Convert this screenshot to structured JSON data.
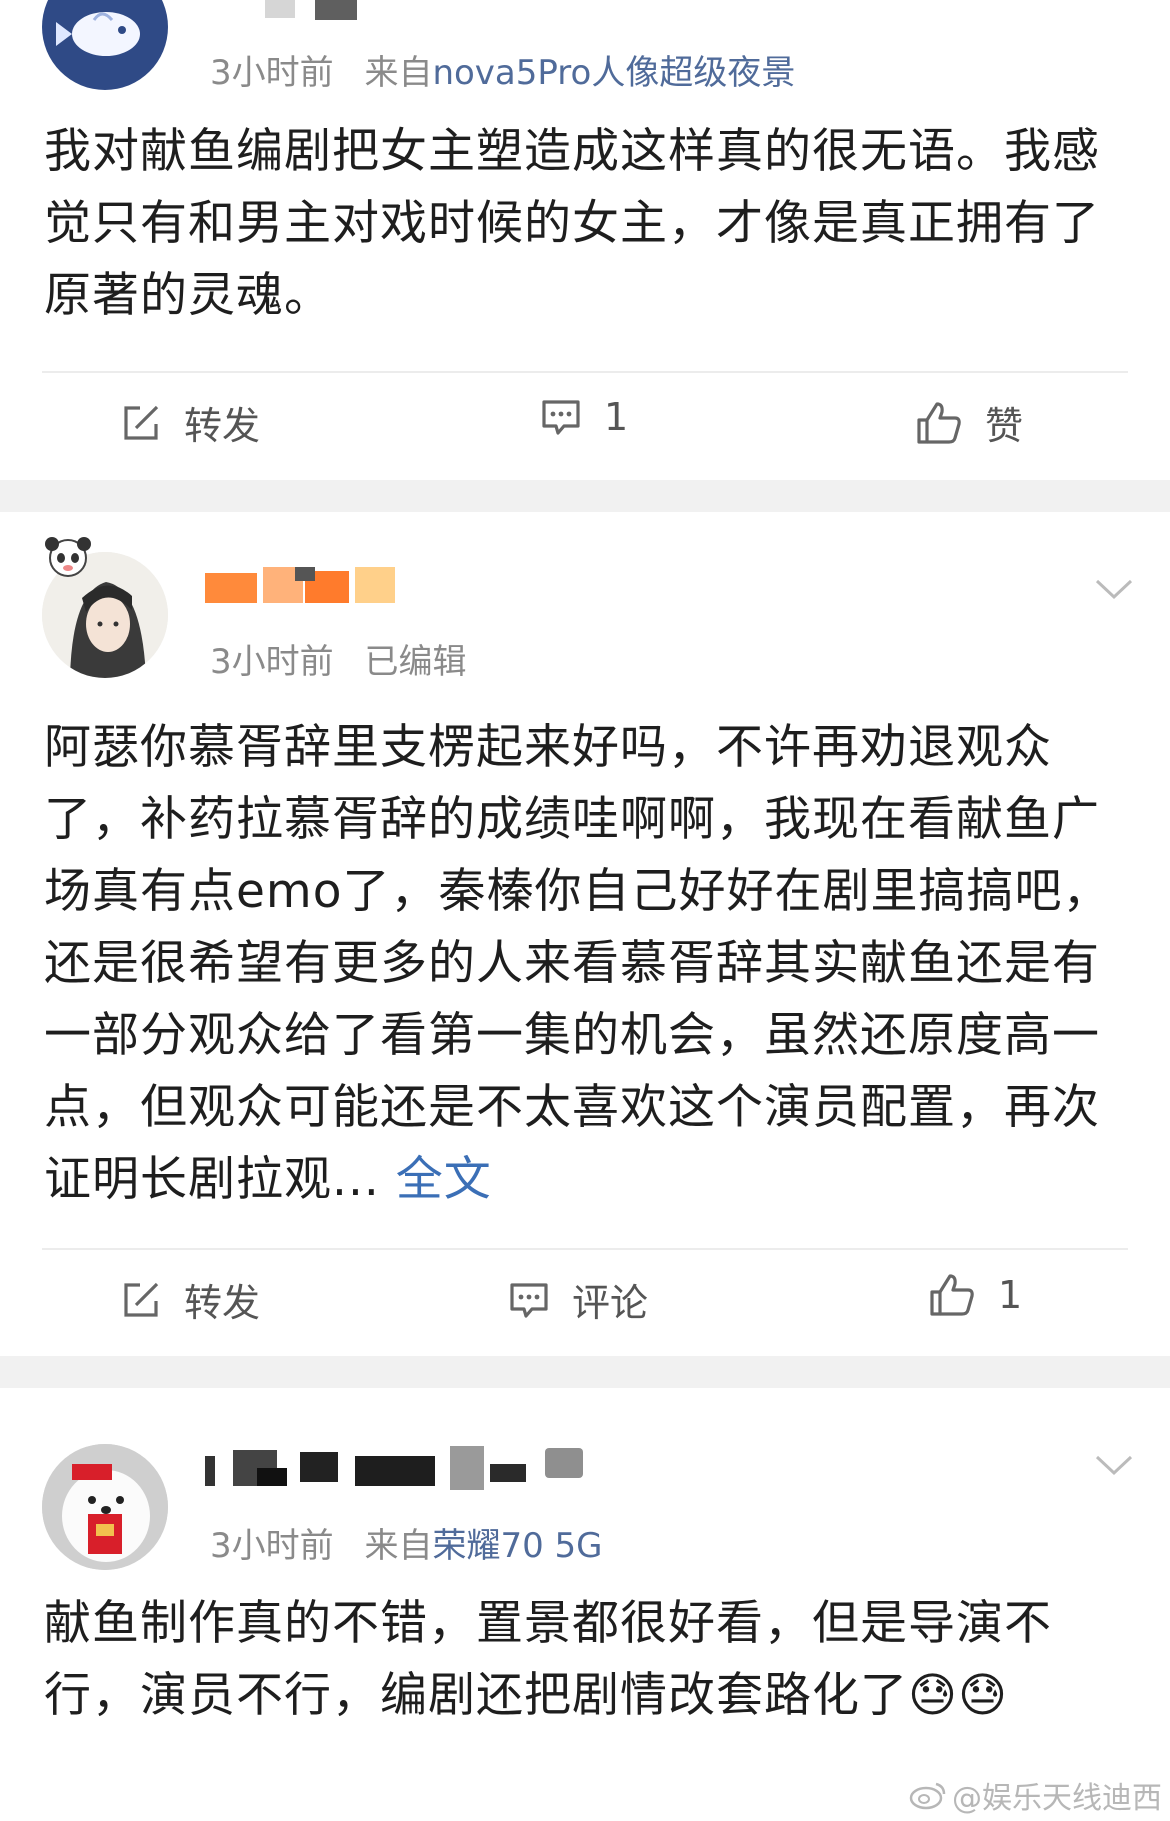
{
  "posts": [
    {
      "time": "3小时前",
      "source_prefix": "来自",
      "source": "nova5Pro人像超级夜景",
      "text": "我对献鱼编剧把女主塑造成这样真的很无语。我感觉只有和男主对戏时候的女主，才像是真正拥有了原著的灵魂。",
      "actions": {
        "repost": "转发",
        "comment": "1",
        "like": "赞"
      }
    },
    {
      "time": "3小时前",
      "edited": "已编辑",
      "text": "阿瑟你慕胥辞里支楞起来好吗，不许再劝退观众了，补药拉慕胥辞的成绩哇啊啊，我现在看献鱼广场真有点emo了，秦榛你自己好好在剧里搞搞吧，还是很希望有更多的人来看慕胥辞其实献鱼还是有一部分观众给了看第一集的机会，虽然还原度高一点，但观众可能还是不太喜欢这个演员配置，再次证明长剧拉观...",
      "more": "全文",
      "actions": {
        "repost": "转发",
        "comment": "评论",
        "like": "1"
      }
    },
    {
      "time": "3小时前",
      "source_prefix": "来自",
      "source": "荣耀70 5G",
      "text": "献鱼制作真的不错，置景都很好看，但是导演不行，演员不行，编剧还把剧情改套路化了😓😓"
    }
  ],
  "watermark": "@娱乐天线迪西",
  "icons": [
    "repost-icon",
    "comment-icon",
    "like-icon",
    "chevron-down-icon",
    "weibo-logo-icon"
  ]
}
